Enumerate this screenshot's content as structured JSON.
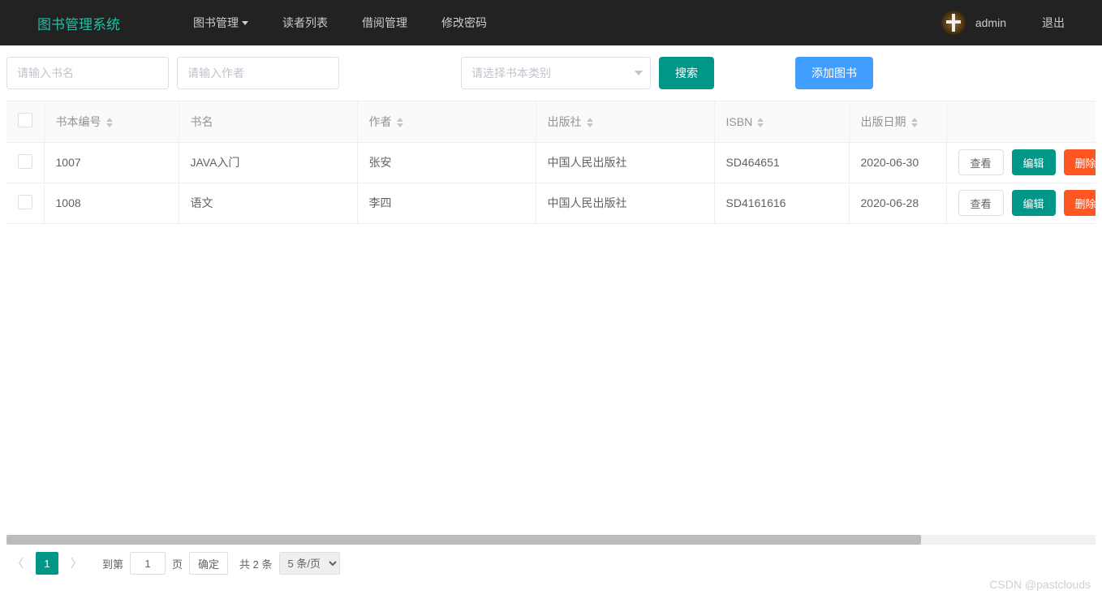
{
  "brand": "图书管理系统",
  "nav": {
    "book_manage": "图书管理",
    "reader_list": "读者列表",
    "borrow_manage": "借阅管理",
    "change_pwd": "修改密码"
  },
  "user": {
    "name": "admin",
    "logout": "退出"
  },
  "toolbar": {
    "title_placeholder": "请输入书名",
    "author_placeholder": "请输入作者",
    "category_placeholder": "请选择书本类别",
    "search_label": "搜索",
    "add_label": "添加图书"
  },
  "table": {
    "headers": {
      "id": "书本编号",
      "name": "书名",
      "author": "作者",
      "publisher": "出版社",
      "isbn": "ISBN",
      "date": "出版日期"
    },
    "rows": [
      {
        "id": "1007",
        "name": "JAVA入门",
        "author": "张安",
        "publisher": "中国人民出版社",
        "isbn": "SD464651",
        "date": "2020-06-30"
      },
      {
        "id": "1008",
        "name": "语文",
        "author": "李四",
        "publisher": "中国人民出版社",
        "isbn": "SD4161616",
        "date": "2020-06-28"
      }
    ],
    "actions": {
      "view": "查看",
      "edit": "编辑",
      "delete": "删除"
    }
  },
  "pager": {
    "current": "1",
    "goto_prefix": "到第",
    "goto_input": "1",
    "goto_suffix": "页",
    "confirm": "确定",
    "total": "共 2 条",
    "per_page": "5 条/页"
  },
  "watermark": "CSDN @pastclouds"
}
